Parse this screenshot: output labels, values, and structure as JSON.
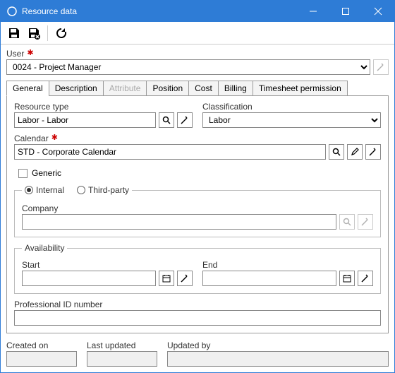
{
  "window": {
    "title": "Resource data"
  },
  "user": {
    "label": "User",
    "value": "0024 - Project Manager"
  },
  "tabs": {
    "general": "General",
    "description": "Description",
    "attribute": "Attribute",
    "position": "Position",
    "cost": "Cost",
    "billing": "Billing",
    "timesheet": "Timesheet permission"
  },
  "general": {
    "resource_type_label": "Resource type",
    "resource_type_value": "Labor - Labor",
    "classification_label": "Classification",
    "classification_value": "Labor",
    "calendar_label": "Calendar",
    "calendar_value": "STD - Corporate Calendar",
    "generic_label": "Generic",
    "internal_label": "Internal",
    "thirdparty_label": "Third-party",
    "company_label": "Company",
    "company_value": "",
    "availability_legend": "Availability",
    "start_label": "Start",
    "start_value": "",
    "end_label": "End",
    "end_value": "",
    "prof_id_label": "Professional ID number",
    "prof_id_value": ""
  },
  "footer": {
    "created_on_label": "Created on",
    "created_on_value": "",
    "last_updated_label": "Last updated",
    "last_updated_value": "",
    "updated_by_label": "Updated by",
    "updated_by_value": ""
  }
}
